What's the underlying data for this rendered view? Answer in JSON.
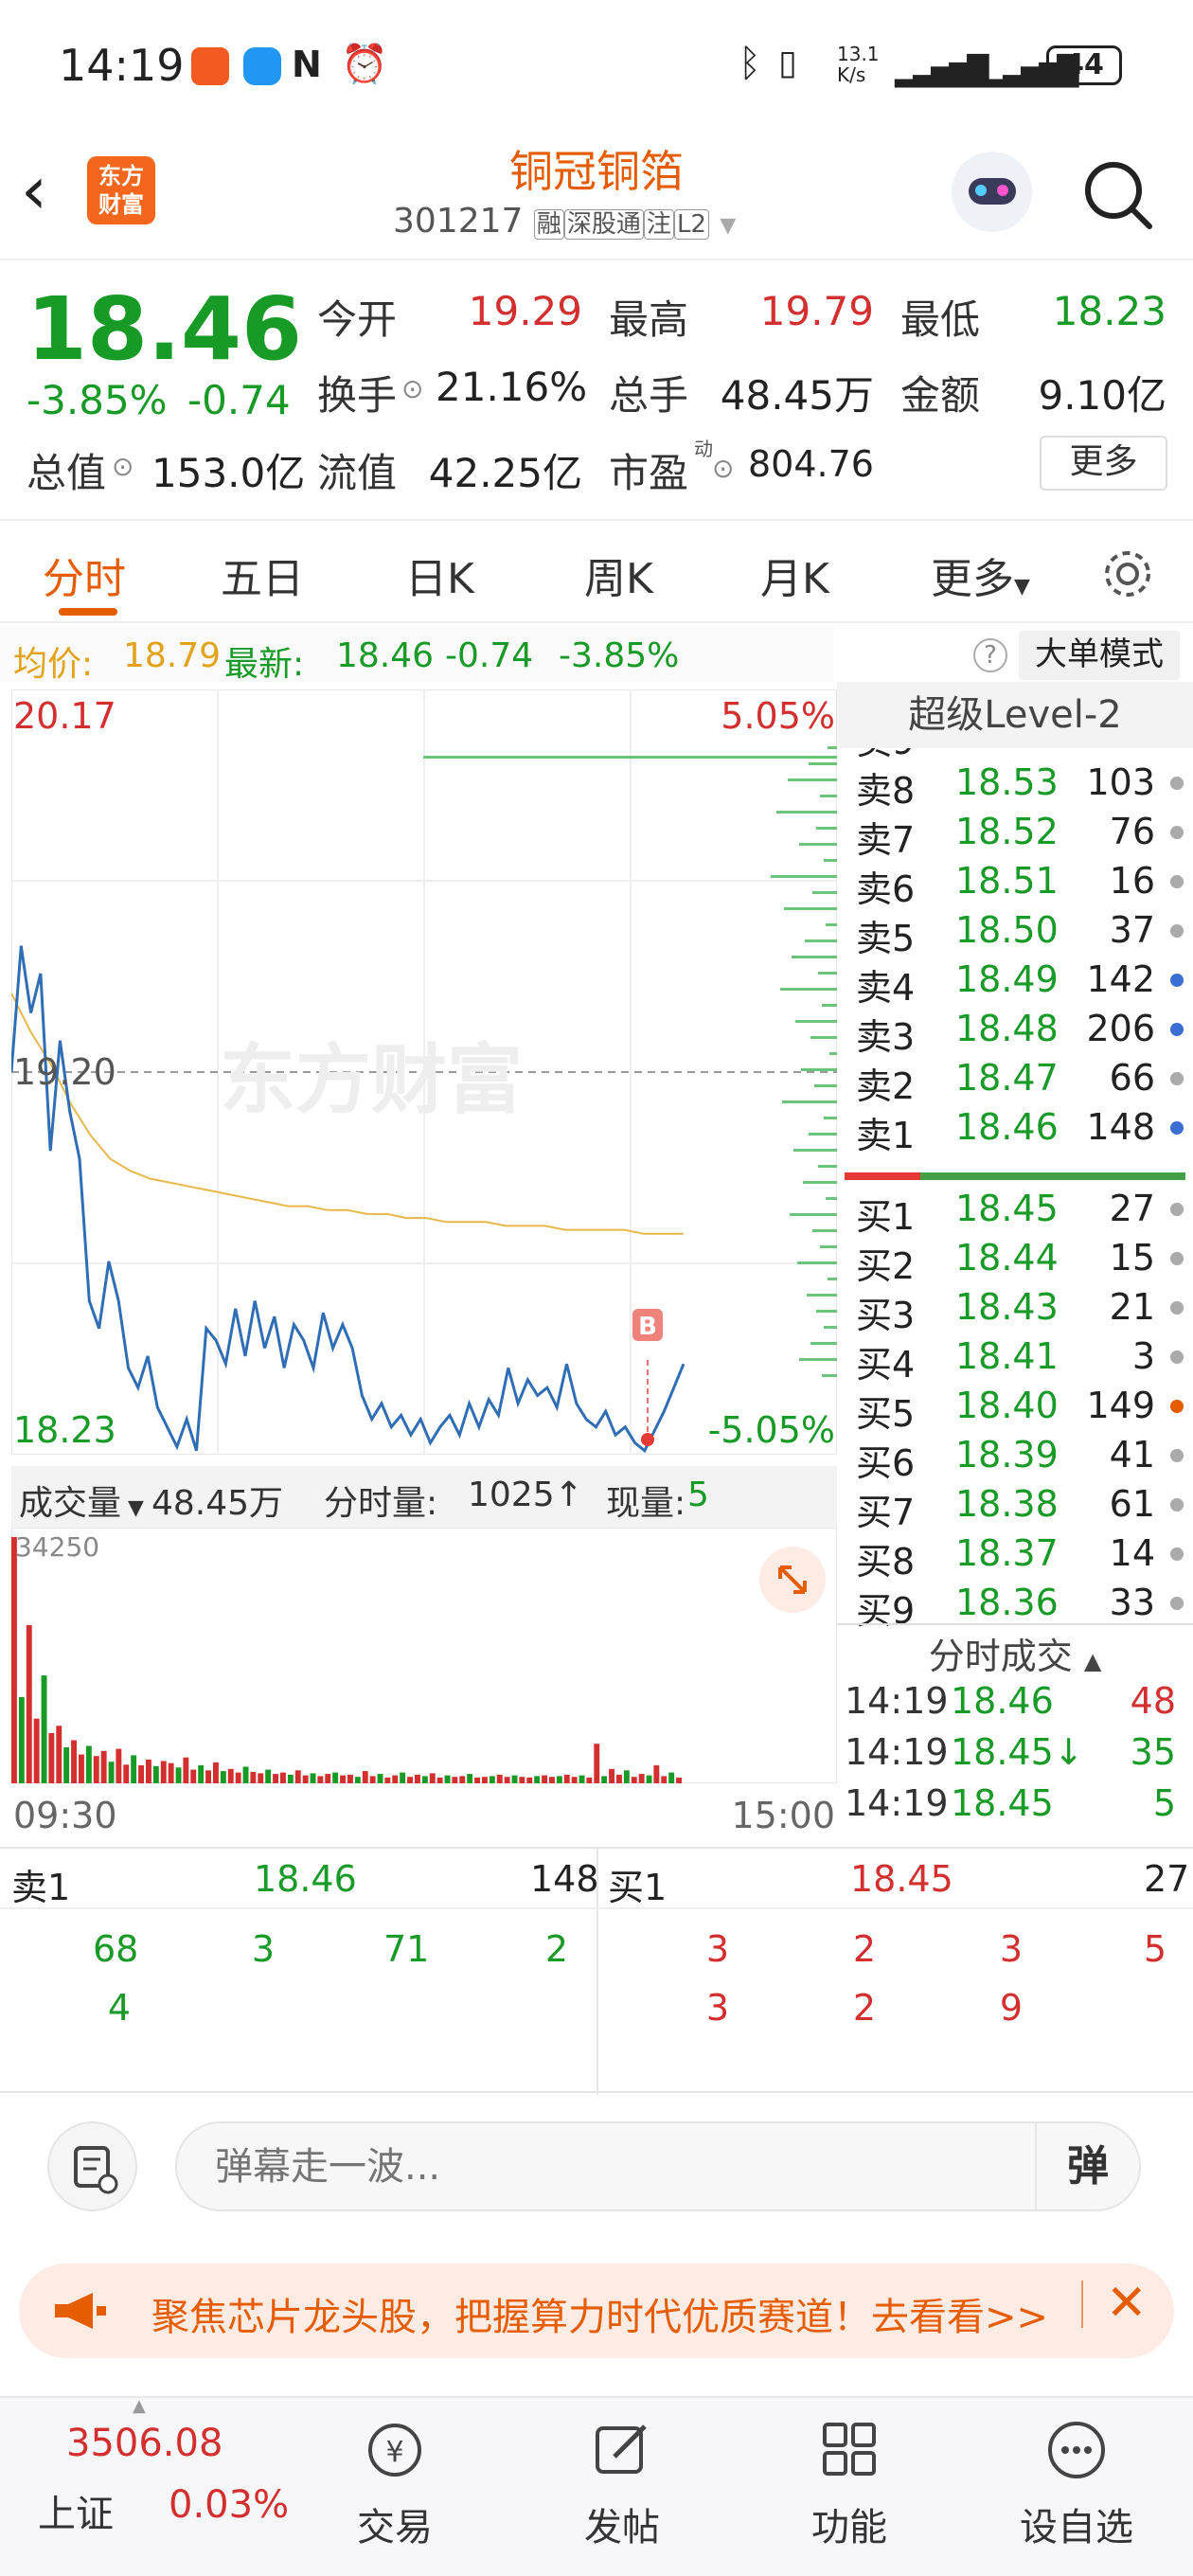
{
  "status_bar": {
    "time": "14:19",
    "net_speed_top": "13.1",
    "net_speed_bottom": "K/s",
    "battery": "44"
  },
  "header": {
    "stock_name": "铜冠铜箔",
    "code": "301217",
    "tags": [
      "融",
      "深股通",
      "注",
      "L2"
    ],
    "logo_text_1": "东方",
    "logo_text_2": "财富"
  },
  "quote": {
    "price": "18.46",
    "change_pct": "-3.85%",
    "change": "-0.74",
    "open_label": "今开",
    "open": "19.29",
    "high_label": "最高",
    "high": "19.79",
    "low_label": "最低",
    "low": "18.23",
    "turnover_label": "换手",
    "turnover": "21.16%",
    "volume_label": "总手",
    "volume": "48.45万",
    "amount_label": "金额",
    "amount": "9.10亿",
    "mktcap_label": "总值",
    "mktcap": "153.0亿",
    "float_label": "流值",
    "float": "42.25亿",
    "pe_label": "市盈",
    "pe_sup": "动",
    "pe": "804.76",
    "more_button": "更多"
  },
  "tabs": [
    {
      "label": "分时"
    },
    {
      "label": "五日"
    },
    {
      "label": "日K"
    },
    {
      "label": "周K"
    },
    {
      "label": "月K"
    },
    {
      "label": "更多"
    }
  ],
  "intraday": {
    "avg_label": "均价:",
    "avg": "18.79",
    "last_label": "最新:",
    "last": "18.46",
    "last_chg": "-0.74",
    "last_pct": "-3.85%",
    "big_order_button": "大单模式",
    "y_top": "20.17",
    "y_mid": "19.20",
    "y_bottom": "18.23",
    "pct_top": "5.05%",
    "pct_bottom": "-5.05%",
    "watermark": "东方财富",
    "marker": "B",
    "time_start": "09:30",
    "time_end": "15:00"
  },
  "volume_bar": {
    "label": "成交量",
    "total": "48.45万",
    "tick_label": "分时量:",
    "tick": "1025",
    "now_label": "现量:",
    "now": "5",
    "max": "34250"
  },
  "chart_data": {
    "type": "line",
    "title": "",
    "series": [
      {
        "name": "",
        "values": [
          19.2,
          19.52,
          19.35,
          19.45,
          19.0,
          19.28,
          19.1,
          18.98,
          18.62,
          18.55,
          18.72,
          18.62,
          18.45,
          18.4,
          18.48,
          18.35,
          18.3,
          18.25,
          18.32,
          18.24,
          18.55,
          18.52,
          18.46,
          18.6,
          18.48,
          18.62,
          18.5,
          18.58,
          18.45,
          18.56,
          18.52,
          18.45,
          18.59,
          18.5,
          18.56,
          18.5,
          18.38,
          18.32,
          18.36,
          18.3,
          18.33,
          18.28,
          18.32,
          18.26,
          18.3,
          18.33,
          18.28,
          18.36,
          18.3,
          18.37,
          18.33,
          18.45,
          18.36,
          18.42,
          18.38,
          18.4,
          18.35,
          18.46,
          18.36,
          18.32,
          18.3,
          18.34,
          18.28,
          18.3,
          18.26,
          18.24,
          18.29,
          18.34,
          18.4,
          18.46
        ]
      },
      {
        "name": "",
        "values": [
          19.4,
          19.3,
          19.22,
          19.12,
          19.04,
          18.98,
          18.95,
          18.93,
          18.92,
          18.91,
          18.9,
          18.89,
          18.88,
          18.87,
          18.86,
          18.86,
          18.85,
          18.85,
          18.84,
          18.84,
          18.83,
          18.83,
          18.82,
          18.82,
          18.82,
          18.81,
          18.81,
          18.81,
          18.8,
          18.8,
          18.8,
          18.8,
          18.79,
          18.79,
          18.79
        ]
      }
    ],
    "ylim": [
      18.23,
      20.17
    ],
    "volume": [
      34250,
      12000,
      22000,
      9000,
      15000,
      7000,
      8000,
      5000,
      6000,
      4000,
      5200,
      3800,
      4500,
      3000,
      4800,
      2600,
      3900,
      2500,
      3300,
      2400,
      3100,
      2800,
      2200,
      3600,
      1900,
      2500,
      1800,
      2900,
      1700,
      2000,
      1500,
      2300,
      1600,
      1400,
      1900,
      1300,
      1500,
      1200,
      1800,
      1100,
      1400,
      1000,
      1300,
      1500,
      1100,
      1200,
      900,
      1700,
      1000,
      1300,
      800,
      1100,
      1500,
      900,
      1200,
      1000,
      1400,
      800,
      1100,
      900,
      1000,
      1300,
      800,
      900,
      1000,
      1200,
      900,
      1100,
      900,
      800,
      1000,
      1100,
      900,
      1000,
      1200,
      900,
      1100,
      800,
      5500,
      1000,
      2000,
      1200,
      1800,
      900,
      1300,
      1100,
      2500,
      1000,
      1500,
      800
    ]
  },
  "order_book": {
    "title": "超级Level-2",
    "asks": [
      {
        "label": "卖8",
        "price": "18.53",
        "vol": "103",
        "dot": "gray"
      },
      {
        "label": "卖7",
        "price": "18.52",
        "vol": "76",
        "dot": "gray"
      },
      {
        "label": "卖6",
        "price": "18.51",
        "vol": "16",
        "dot": "gray"
      },
      {
        "label": "卖5",
        "price": "18.50",
        "vol": "37",
        "dot": "gray"
      },
      {
        "label": "卖4",
        "price": "18.49",
        "vol": "142",
        "dot": "blue"
      },
      {
        "label": "卖3",
        "price": "18.48",
        "vol": "206",
        "dot": "blue"
      },
      {
        "label": "卖2",
        "price": "18.47",
        "vol": "66",
        "dot": "gray"
      },
      {
        "label": "卖1",
        "price": "18.46",
        "vol": "148",
        "dot": "blue"
      }
    ],
    "bids": [
      {
        "label": "买1",
        "price": "18.45",
        "vol": "27",
        "dot": "gray"
      },
      {
        "label": "买2",
        "price": "18.44",
        "vol": "15",
        "dot": "gray"
      },
      {
        "label": "买3",
        "price": "18.43",
        "vol": "21",
        "dot": "gray"
      },
      {
        "label": "买4",
        "price": "18.41",
        "vol": "3",
        "dot": "gray"
      },
      {
        "label": "买5",
        "price": "18.40",
        "vol": "149",
        "dot": "orange"
      },
      {
        "label": "买6",
        "price": "18.39",
        "vol": "41",
        "dot": "gray"
      },
      {
        "label": "买7",
        "price": "18.38",
        "vol": "61",
        "dot": "gray"
      },
      {
        "label": "买8",
        "price": "18.37",
        "vol": "14",
        "dot": "gray"
      },
      {
        "label": "买9",
        "price": "18.36",
        "vol": "33",
        "dot": "gray"
      }
    ],
    "trades_title": "分时成交",
    "trades": [
      {
        "time": "14:19",
        "price": "18.46",
        "arrow": "",
        "vol": "48",
        "color": "red"
      },
      {
        "time": "14:19",
        "price": "18.45",
        "arrow": "↓",
        "vol": "35",
        "color": "green"
      },
      {
        "time": "14:19",
        "price": "18.45",
        "arrow": "",
        "vol": "5",
        "color": "green"
      }
    ]
  },
  "queue": {
    "sell_label": "卖1",
    "sell_price": "18.46",
    "sell_vol": "148",
    "buy_label": "买1",
    "buy_price": "18.45",
    "buy_vol": "27",
    "sell_orders_row1": [
      "68",
      "3",
      "71",
      "2"
    ],
    "sell_orders_row2": [
      "4"
    ],
    "buy_orders_row1": [
      "3",
      "2",
      "3",
      "5"
    ],
    "buy_orders_row2": [
      "3",
      "2",
      "9"
    ]
  },
  "comment": {
    "placeholder": "弹幕走一波...",
    "danmu_button": "弹"
  },
  "banner": {
    "text": "聚焦芯片龙头股，把握算力时代优质赛道！去看看>>"
  },
  "bottom_nav": {
    "index_value": "3506.08",
    "index_name": "上证",
    "index_pct": "0.03%",
    "items": [
      {
        "label": "交易"
      },
      {
        "label": "发帖"
      },
      {
        "label": "功能"
      },
      {
        "label": "设自选"
      }
    ]
  },
  "colors": {
    "up": "#d32f2f",
    "down": "#189a27",
    "accent": "#e65c00",
    "line": "#2f6db5",
    "avg": "#e7b84a"
  }
}
